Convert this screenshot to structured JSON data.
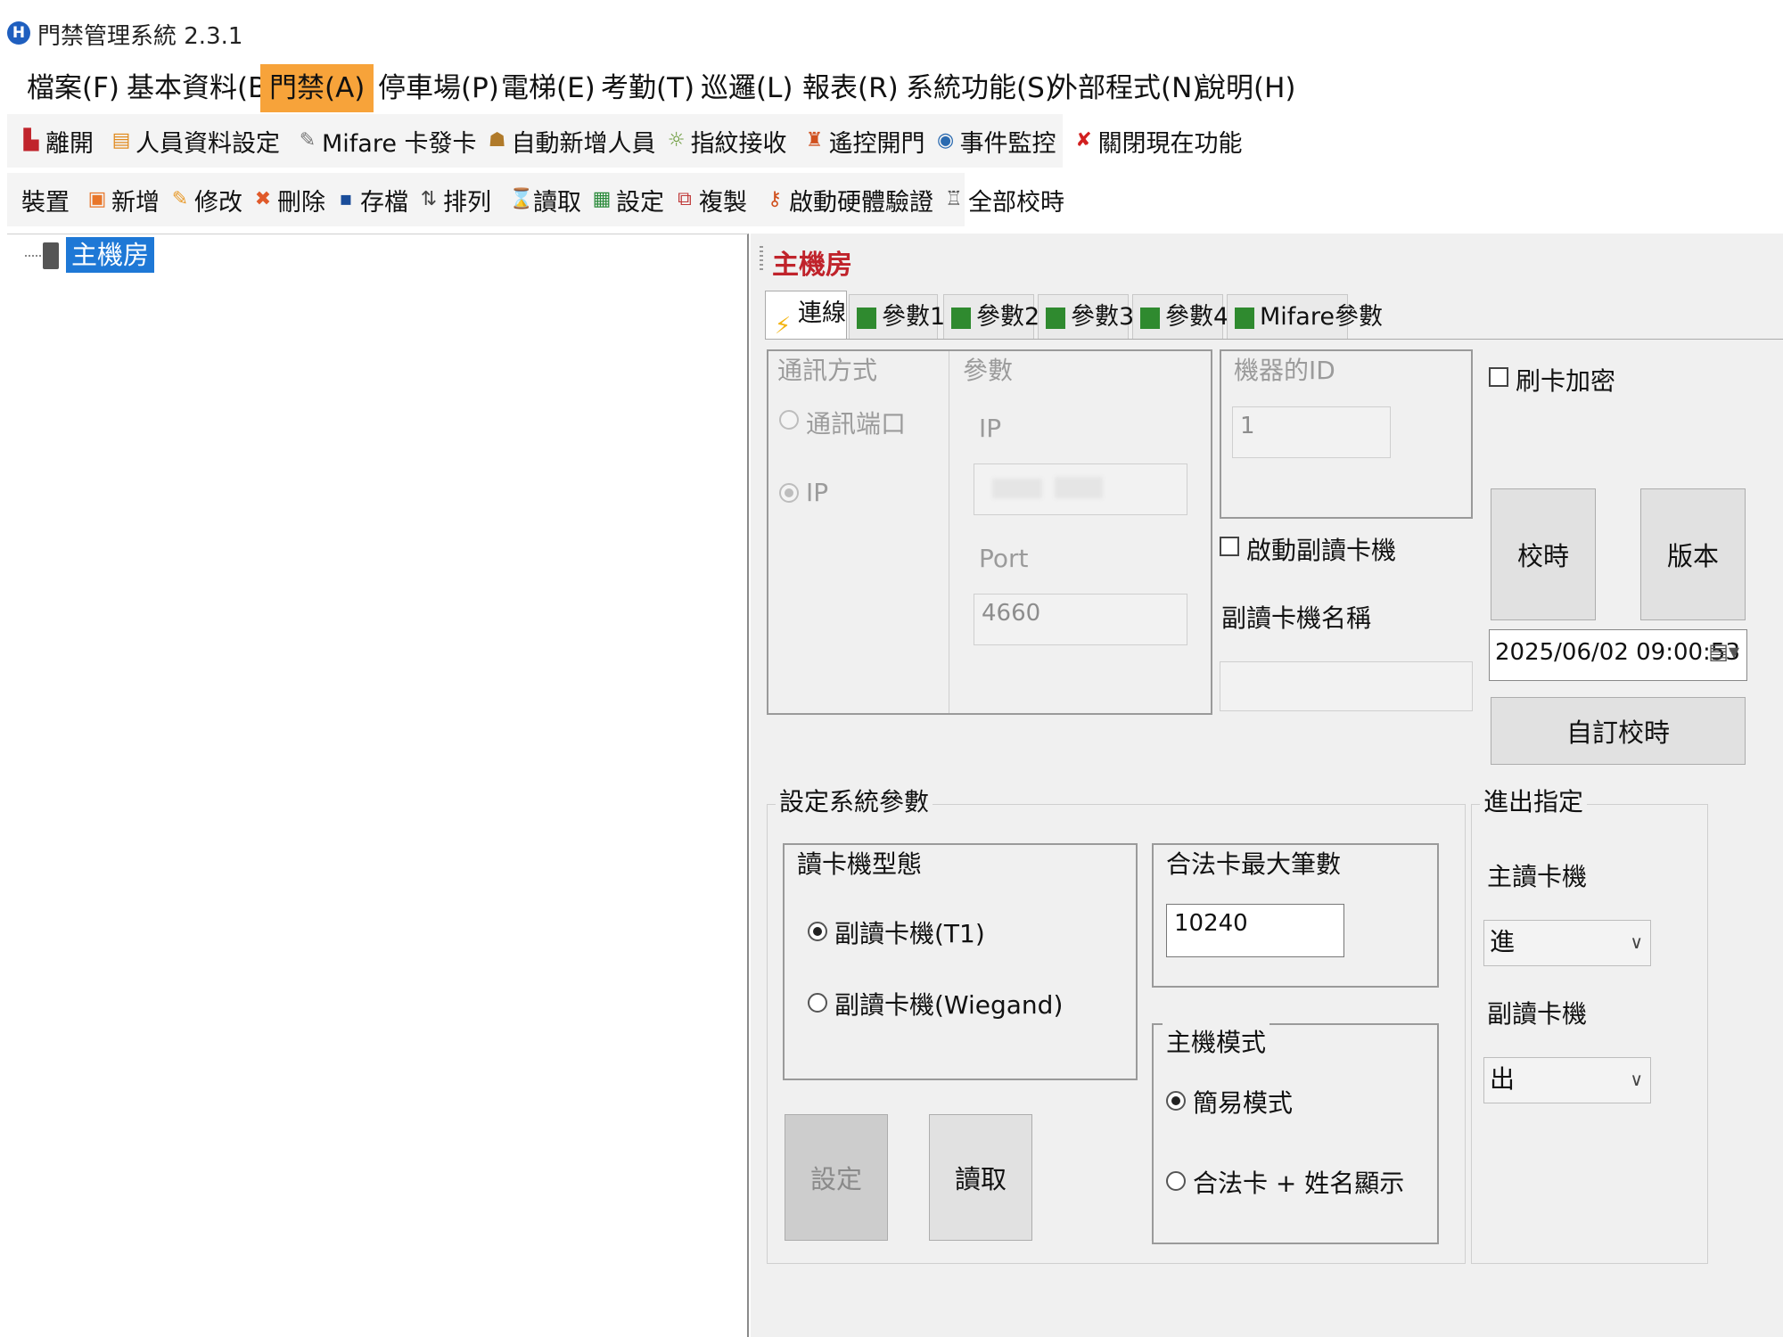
{
  "app": {
    "title": "門禁管理系統  2.3.1",
    "icon_label": "H"
  },
  "menubar": {
    "items": [
      "檔案(F)",
      "基本資料(B)",
      "門禁(A)",
      "停車場(P)",
      "電梯(E)",
      "考勤(T)",
      "巡邏(L)",
      "報表(R)",
      "系統功能(S)",
      "外部程式(N)",
      "說明(H)"
    ],
    "active_index": 2,
    "active_color": "#f7a33a"
  },
  "toolbar1": {
    "items": [
      {
        "label": "離開",
        "icon": "exit-door-icon"
      },
      {
        "label": "人員資料設定",
        "icon": "person-card-icon"
      },
      {
        "label": "Mifare 卡發卡",
        "icon": "card-issue-icon"
      },
      {
        "label": "自動新增人員",
        "icon": "person-add-icon"
      },
      {
        "label": "指紋接收",
        "icon": "fingerprint-icon"
      },
      {
        "label": "遙控開門",
        "icon": "unlock-icon"
      },
      {
        "label": "事件監控",
        "icon": "eye-icon"
      },
      {
        "label": "關閉現在功能",
        "icon": "close-x-icon"
      }
    ]
  },
  "toolbar2": {
    "device_label": "裝置",
    "items": [
      {
        "label": "新增",
        "icon": "add-icon"
      },
      {
        "label": "修改",
        "icon": "edit-icon"
      },
      {
        "label": "刪除",
        "icon": "delete-icon"
      },
      {
        "label": "存檔",
        "icon": "save-icon"
      },
      {
        "label": "排列",
        "icon": "sort-icon"
      },
      {
        "label": "讀取",
        "icon": "hourglass-icon"
      },
      {
        "label": "設定",
        "icon": "chip-icon"
      },
      {
        "label": "複製",
        "icon": "copy-icon"
      },
      {
        "label": "啟動硬體驗證",
        "icon": "key-icon"
      },
      {
        "label": "全部校時",
        "icon": "clock-sync-icon"
      }
    ]
  },
  "tree": {
    "root_label": "主機房"
  },
  "panel": {
    "title": "主機房",
    "title_color": "#c0232b",
    "tabs": [
      "連線",
      "參數1",
      "參數2",
      "參數3",
      "參數4",
      "Mifare參數"
    ],
    "active_tab": 0
  },
  "connection": {
    "method_legend": "通訊方式",
    "param_legend": "參數",
    "radio_port": "通訊端口",
    "radio_ip": "IP",
    "ip_label": "IP",
    "port_label": "Port",
    "port_value": "4660",
    "machine_id_legend": "機器的ID",
    "machine_id_value": "1",
    "enable_sub_reader": "啟動副讀卡機",
    "sub_reader_name_label": "副讀卡機名稱",
    "sub_reader_name_value": "",
    "card_encrypt": "刷卡加密",
    "btn_time_sync": "校時",
    "btn_version": "版本",
    "datetime_value": "2025/06/02 09:00:53",
    "btn_custom_sync": "自訂校時"
  },
  "system_params": {
    "legend": "設定系統參數",
    "reader_type_legend": "讀卡機型態",
    "reader_t1": "副讀卡機(T1)",
    "reader_wiegand": "副讀卡機(Wiegand)",
    "max_cards_legend": "合法卡最大筆數",
    "max_cards_value": "10240",
    "host_mode_legend": "主機模式",
    "mode_simple": "簡易模式",
    "mode_card_name": "合法卡 + 姓名顯示",
    "btn_set": "設定",
    "btn_read": "讀取"
  },
  "inout": {
    "legend": "進出指定",
    "main_reader_label": "主讀卡機",
    "main_reader_value": "進",
    "sub_reader_label": "副讀卡機",
    "sub_reader_value": "出"
  }
}
